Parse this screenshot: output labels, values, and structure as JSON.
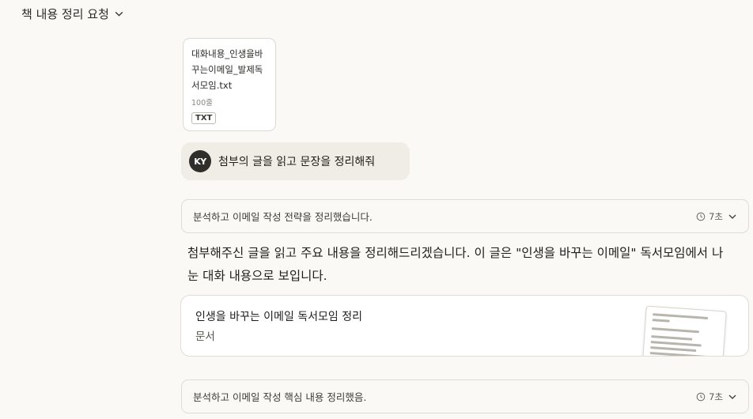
{
  "conversation": {
    "title": "책 내용 정리 요청"
  },
  "attachment": {
    "name": "대화내용_인생을바꾸는이메일_발제독서모임.txt",
    "lines": "100줄",
    "type": "TXT"
  },
  "user_message": {
    "avatar": "KY",
    "text": "첨부의 글을 읽고 문장을 정리해줘"
  },
  "thinking_1": {
    "label": "분석하고 이메일 작성 전략을 정리했습니다.",
    "duration": "7초"
  },
  "reply": {
    "text": "첨부해주신 글을 읽고 주요 내용을 정리해드리겠습니다. 이 글은 \"인생을 바꾸는 이메일\" 독서모임에서 나눈 대화 내용으로 보입니다."
  },
  "artifact": {
    "title": "인생을 바꾸는 이메일 독서모임 정리",
    "type": "문서"
  },
  "thinking_2": {
    "label": "분석하고 이메일 작성 핵심 내용 정리했음.",
    "duration": "7초"
  },
  "icons": {
    "title_chevron": "chevron-down-icon",
    "clock": "clock-icon",
    "expand": "chevron-down-icon"
  }
}
